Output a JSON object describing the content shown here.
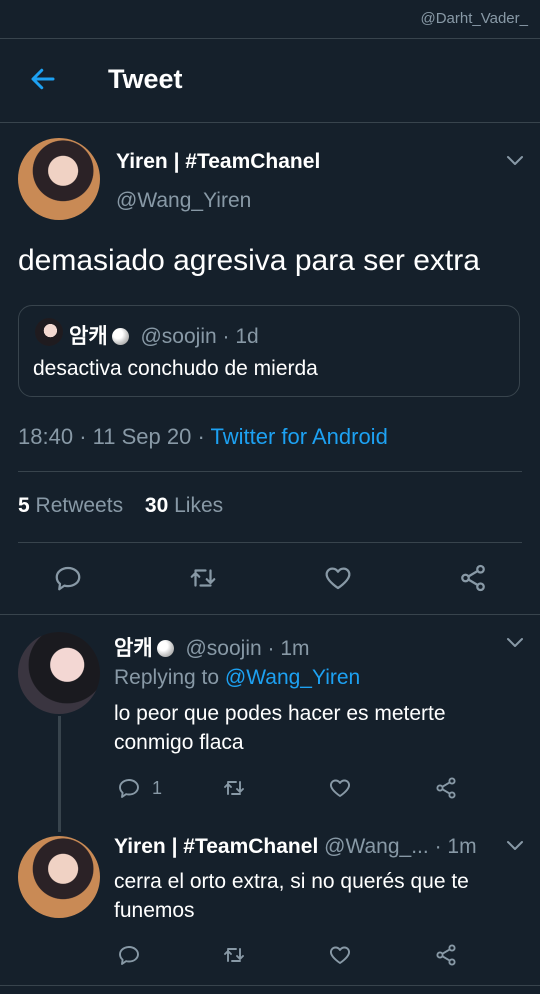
{
  "watermark": "@Darht_Vader_",
  "header": {
    "title": "Tweet"
  },
  "main_tweet": {
    "name": "Yiren | #TeamChanel",
    "handle": "@Wang_Yiren",
    "text": "demasiado agresiva para ser extra",
    "quote": {
      "name": "암캐",
      "handle": "@soojin",
      "time": "· 1d",
      "text": "desactiva conchudo de mierda"
    },
    "meta": {
      "time": "18:40",
      "date": "11 Sep 20",
      "source": "Twitter for Android"
    },
    "stats": {
      "retweets_count": "5",
      "retweets_label": "Retweets",
      "likes_count": "30",
      "likes_label": "Likes"
    }
  },
  "replies": [
    {
      "name": "암캐",
      "handle": "@soojin",
      "time": "· 1m",
      "replying_label": "Replying to",
      "replying_handle": "@Wang_Yiren",
      "text_line1": "lo peor que podes hacer es meterte",
      "text_line2": "conmigo flaca",
      "reply_count": "1"
    },
    {
      "name": "Yiren | #TeamChanel",
      "handle": "@Wang_...",
      "time": "· 1m",
      "text_line1": "cerra el orto extra, si no querés que te",
      "text_line2": "funemos"
    }
  ],
  "colors": {
    "background": "#15202b",
    "accent": "#1da1f2",
    "muted": "#8899a6",
    "divider": "#38444d"
  }
}
